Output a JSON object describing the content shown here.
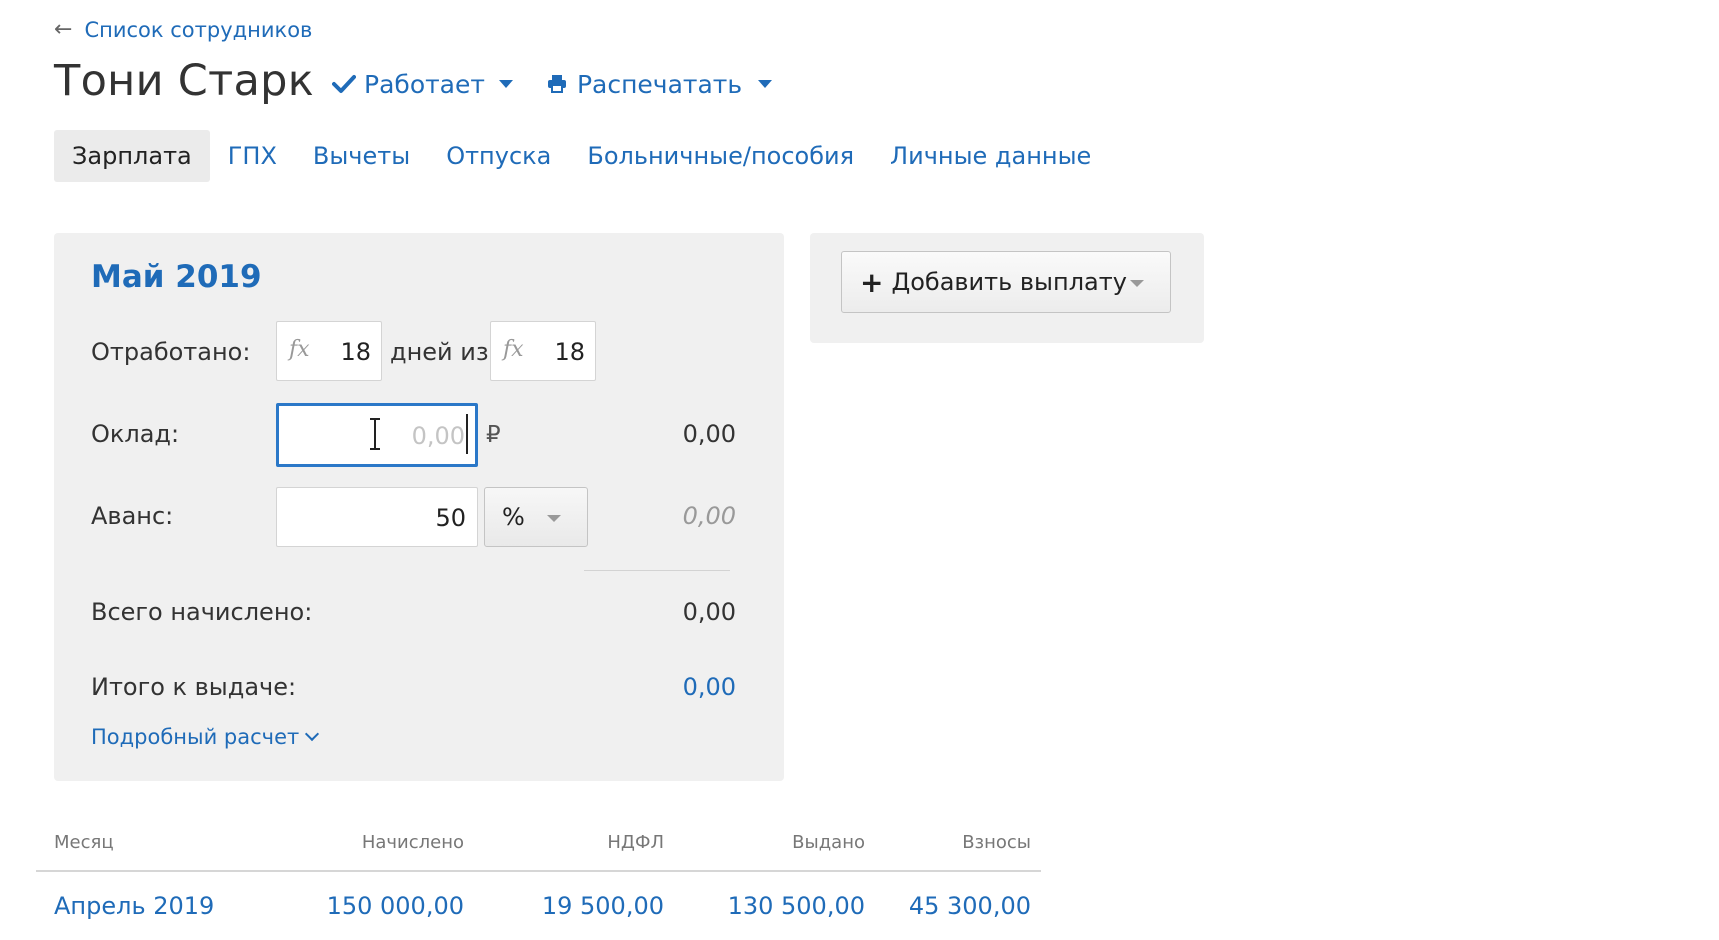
{
  "header": {
    "back_arrow": "←",
    "back_label": "Список сотрудников",
    "employee_name": "Тони Старк",
    "status_label": "Работает",
    "print_label": "Распечатать"
  },
  "tabs": [
    {
      "label": "Зарплата",
      "active": true
    },
    {
      "label": "ГПХ"
    },
    {
      "label": "Вычеты"
    },
    {
      "label": "Отпуска"
    },
    {
      "label": "Больничные/пособия"
    },
    {
      "label": "Личные данные"
    }
  ],
  "salary_card": {
    "period": "Май 2019",
    "worked_label": "Отработано:",
    "worked_days": "18",
    "days_of_label": "дней из",
    "total_days": "18",
    "fx_symbol": "fx",
    "salary_label": "Оклад:",
    "salary_placeholder": "0,00",
    "currency_symbol": "₽",
    "salary_amount": "0,00",
    "advance_label": "Аванс:",
    "advance_value": "50",
    "advance_unit": "%",
    "advance_amount": "0,00",
    "accrued_label": "Всего начислено:",
    "accrued_amount": "0,00",
    "payout_label": "Итого к выдаче:",
    "payout_amount": "0,00",
    "details_link": "Подробный расчет"
  },
  "side_panel": {
    "add_payment_plus": "+",
    "add_payment_label": "Добавить выплату"
  },
  "history": {
    "columns": [
      "Месяц",
      "Начислено",
      "НДФЛ",
      "Выдано",
      "Взносы"
    ],
    "rows": [
      {
        "month": "Апрель 2019",
        "accrued": "150 000,00",
        "ndfl": "19 500,00",
        "paid": "130 500,00",
        "contributions": "45 300,00"
      }
    ]
  },
  "colors": {
    "accent": "#1f6bb8",
    "card_background": "#f0f0f0",
    "focus_border": "#2b78c8"
  },
  "icons": {
    "back": "left-arrow-icon",
    "status": "check-icon",
    "print": "printer-icon",
    "dropdown": "chevron-down-icon",
    "formula": "fx-icon"
  }
}
